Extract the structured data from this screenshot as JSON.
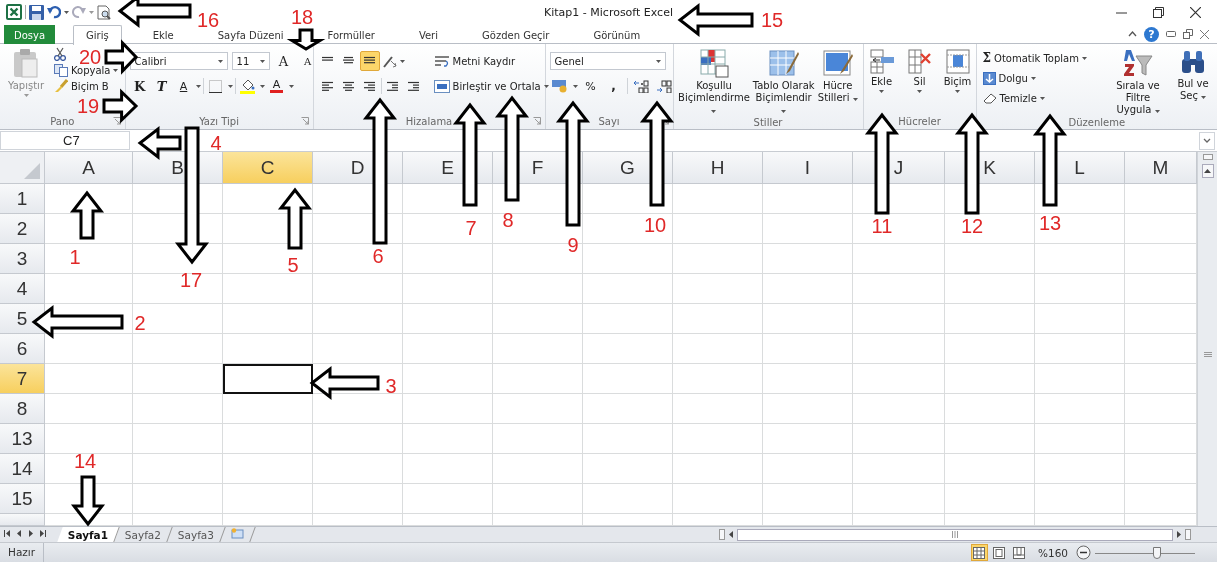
{
  "window": {
    "title": "Kitap1  -  Microsoft Excel"
  },
  "tabs": [
    {
      "label": "Dosya",
      "kind": "file",
      "selected": false
    },
    {
      "label": "Giriş",
      "kind": "tab",
      "selected": true
    },
    {
      "label": "Ekle",
      "kind": "tab",
      "selected": false
    },
    {
      "label": "Sayfa Düzeni",
      "kind": "tab",
      "selected": false
    },
    {
      "label": "Formüller",
      "kind": "tab",
      "selected": false
    },
    {
      "label": "Veri",
      "kind": "tab",
      "selected": false
    },
    {
      "label": "Gözden Geçir",
      "kind": "tab",
      "selected": false
    },
    {
      "label": "Görünüm",
      "kind": "tab",
      "selected": false
    }
  ],
  "help": "?",
  "clipboard": {
    "title": "Pano",
    "paste": "Yapıştır",
    "copy": "Kopyala",
    "format_painter": "Biçim B"
  },
  "font": {
    "title": "Yazı Tipi",
    "name": "Calibri",
    "size": "11",
    "grow": "A",
    "shrink": "A",
    "bold": "K",
    "italic": "T",
    "underline": "A",
    "font_color": "A"
  },
  "alignment": {
    "title": "Hizalama",
    "vertical_align": [
      {
        "selected": false
      },
      {
        "selected": false
      },
      {
        "selected": true
      }
    ],
    "wrap": "Metni Kaydır",
    "merge": "Birleştir ve Ortala"
  },
  "number": {
    "title": "Sayı",
    "format": "Genel",
    "percent": "%",
    "comma": ","
  },
  "styles": {
    "title": "Stiller",
    "items": [
      "Koşullu Biçimlendirme",
      "Tablo Olarak Biçimlendir",
      "Hücre Stilleri"
    ]
  },
  "cells": {
    "title": "Hücreler",
    "items": [
      "Ekle",
      "Sil",
      "Biçim"
    ]
  },
  "editing": {
    "title": "Düzenleme",
    "autosum_icon": "Σ",
    "autosum": "Otomatik Toplam",
    "fill": "Dolgu",
    "clear": "Temizle",
    "sort": "Sırala ve Filtre Uygula",
    "find": "Bul ve Seç"
  },
  "name_box": "C7",
  "columns": [
    {
      "label": "A",
      "selected": false
    },
    {
      "label": "B",
      "selected": false
    },
    {
      "label": "C",
      "selected": true
    },
    {
      "label": "D",
      "selected": false
    },
    {
      "label": "E",
      "selected": false
    },
    {
      "label": "F",
      "selected": false
    },
    {
      "label": "G",
      "selected": false
    },
    {
      "label": "H",
      "selected": false
    },
    {
      "label": "I",
      "selected": false
    },
    {
      "label": "J",
      "selected": false
    },
    {
      "label": "K",
      "selected": false
    },
    {
      "label": "L",
      "selected": false
    },
    {
      "label": "M",
      "selected": false
    }
  ],
  "rows": [
    {
      "label": "1",
      "selected": false
    },
    {
      "label": "2",
      "selected": false
    },
    {
      "label": "3",
      "selected": false
    },
    {
      "label": "4",
      "selected": false
    },
    {
      "label": "5",
      "selected": false
    },
    {
      "label": "6",
      "selected": false
    },
    {
      "label": "7",
      "selected": true
    },
    {
      "label": "8",
      "selected": false
    },
    {
      "label": "13",
      "selected": false
    },
    {
      "label": "14",
      "selected": false
    },
    {
      "label": "15",
      "selected": false
    }
  ],
  "sheets": [
    {
      "label": "Sayfa1",
      "selected": true
    },
    {
      "label": "Sayfa2",
      "selected": false
    },
    {
      "label": "Sayfa3",
      "selected": false
    }
  ],
  "status": {
    "text": "Hazır",
    "views": [
      {
        "selected": true
      },
      {
        "selected": false
      },
      {
        "selected": false
      }
    ],
    "zoom": "%160",
    "zoom_slider": {
      "level": 0.62
    }
  },
  "annotations": [
    {
      "number": "16"
    },
    {
      "number": "18"
    },
    {
      "number": "15"
    },
    {
      "number": "20"
    },
    {
      "number": "19"
    },
    {
      "number": "4"
    },
    {
      "number": "7"
    },
    {
      "number": "8"
    },
    {
      "number": "10"
    },
    {
      "number": "11"
    },
    {
      "number": "12"
    },
    {
      "number": "13"
    },
    {
      "number": "1"
    },
    {
      "number": "17"
    },
    {
      "number": "5"
    },
    {
      "number": "6"
    },
    {
      "number": "9"
    },
    {
      "number": "2"
    },
    {
      "number": "3"
    },
    {
      "number": "14"
    }
  ]
}
